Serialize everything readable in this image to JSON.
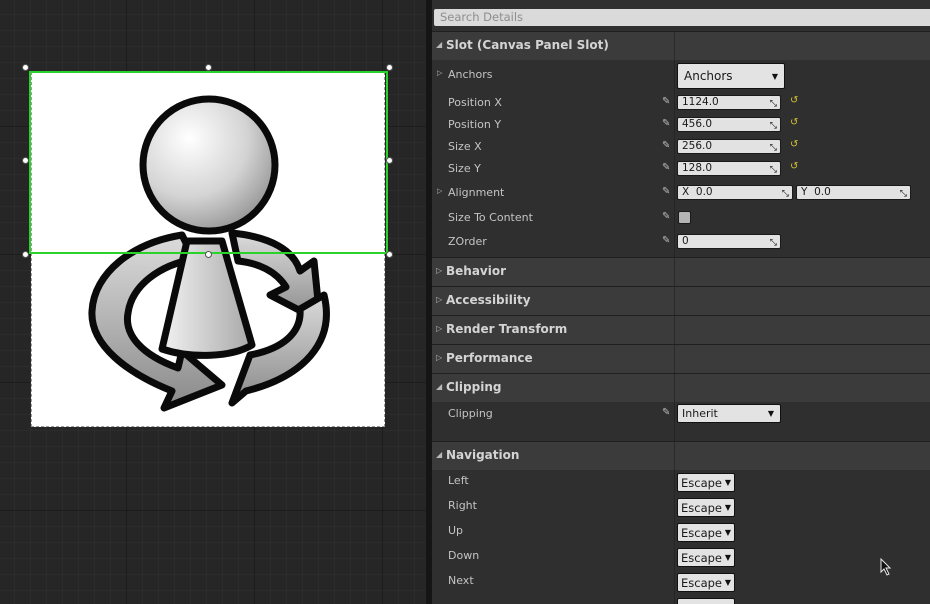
{
  "search": {
    "placeholder": "Search Details"
  },
  "slot": {
    "title": "Slot (Canvas Panel Slot)",
    "anchors": {
      "label": "Anchors",
      "value": "Anchors"
    },
    "position_x": {
      "label": "Position X",
      "value": "1124.0"
    },
    "position_y": {
      "label": "Position Y",
      "value": "456.0"
    },
    "size_x": {
      "label": "Size X",
      "value": "256.0"
    },
    "size_y": {
      "label": "Size Y",
      "value": "128.0"
    },
    "alignment": {
      "label": "Alignment",
      "x_label": "X",
      "x_value": "0.0",
      "y_label": "Y",
      "y_value": "0.0"
    },
    "size_to_content": {
      "label": "Size To Content",
      "checked": false
    },
    "zorder": {
      "label": "ZOrder",
      "value": "0"
    }
  },
  "categories": {
    "behavior": "Behavior",
    "accessibility": "Accessibility",
    "render_transform": "Render Transform",
    "performance": "Performance",
    "clipping": "Clipping",
    "navigation": "Navigation"
  },
  "clipping": {
    "label": "Clipping",
    "value": "Inherit"
  },
  "navigation": {
    "rows": [
      {
        "label": "Left",
        "value": "Escape"
      },
      {
        "label": "Right",
        "value": "Escape"
      },
      {
        "label": "Up",
        "value": "Escape"
      },
      {
        "label": "Down",
        "value": "Escape"
      },
      {
        "label": "Next",
        "value": "Escape"
      }
    ]
  },
  "colors": {
    "selection": "#29d329",
    "panel": "#2f2f2f",
    "category": "#3b3b3b",
    "reset": "#d4c434"
  }
}
